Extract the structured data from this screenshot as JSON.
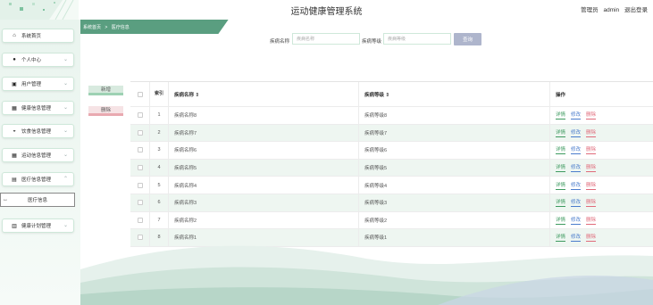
{
  "header": {
    "title": "运动健康管理系统",
    "user_role": "管理员",
    "username": "admin",
    "logout_label": "退出登录"
  },
  "breadcrumb": {
    "home": "系统首页",
    "separator": ">",
    "current": "医疗信息"
  },
  "sidebar": {
    "items": [
      {
        "label": "系统首页",
        "icon": "home-icon"
      },
      {
        "label": "个人中心",
        "icon": "person-icon"
      },
      {
        "label": "用户管理",
        "icon": "user-card-icon"
      },
      {
        "label": "健康信息管理",
        "icon": "grid-icon"
      },
      {
        "label": "饮食信息管理",
        "icon": "bowl-icon"
      },
      {
        "label": "运动信息管理",
        "icon": "grid-icon"
      },
      {
        "label": "医疗信息管理",
        "icon": "document-icon"
      },
      {
        "label": "健康计划管理",
        "icon": "bar-chart-icon"
      }
    ],
    "active_sub": "医疗信息"
  },
  "search": {
    "name_label": "疾病名称",
    "name_placeholder": "疾病名称",
    "level_label": "疾病等级",
    "level_placeholder": "疾病等级",
    "button": "查询"
  },
  "actions": {
    "add": "新增",
    "delete": "删除"
  },
  "table": {
    "headers": {
      "index": "索引",
      "name": "疾病名称 ⇕",
      "level": "疾病等级 ⇕",
      "ops": "操作"
    },
    "op_labels": {
      "detail": "详情",
      "edit": "修改",
      "delete": "删除"
    },
    "rows": [
      {
        "index": "1",
        "name": "疾病名称8",
        "level": "疾病等级8"
      },
      {
        "index": "2",
        "name": "疾病名称7",
        "level": "疾病等级7"
      },
      {
        "index": "3",
        "name": "疾病名称6",
        "level": "疾病等级6"
      },
      {
        "index": "4",
        "name": "疾病名称5",
        "level": "疾病等级5"
      },
      {
        "index": "5",
        "name": "疾病名称4",
        "level": "疾病等级4"
      },
      {
        "index": "6",
        "name": "疾病名称3",
        "level": "疾病等级3"
      },
      {
        "index": "7",
        "name": "疾病名称2",
        "level": "疾病等级2"
      },
      {
        "index": "8",
        "name": "疾病名称1",
        "level": "疾病等级1"
      }
    ]
  },
  "colors": {
    "accent": "#5a9e80",
    "detail": "#3d9a5f",
    "edit": "#4a7ccc",
    "delete": "#e06a7a",
    "search_button": "#aeb5cc"
  }
}
